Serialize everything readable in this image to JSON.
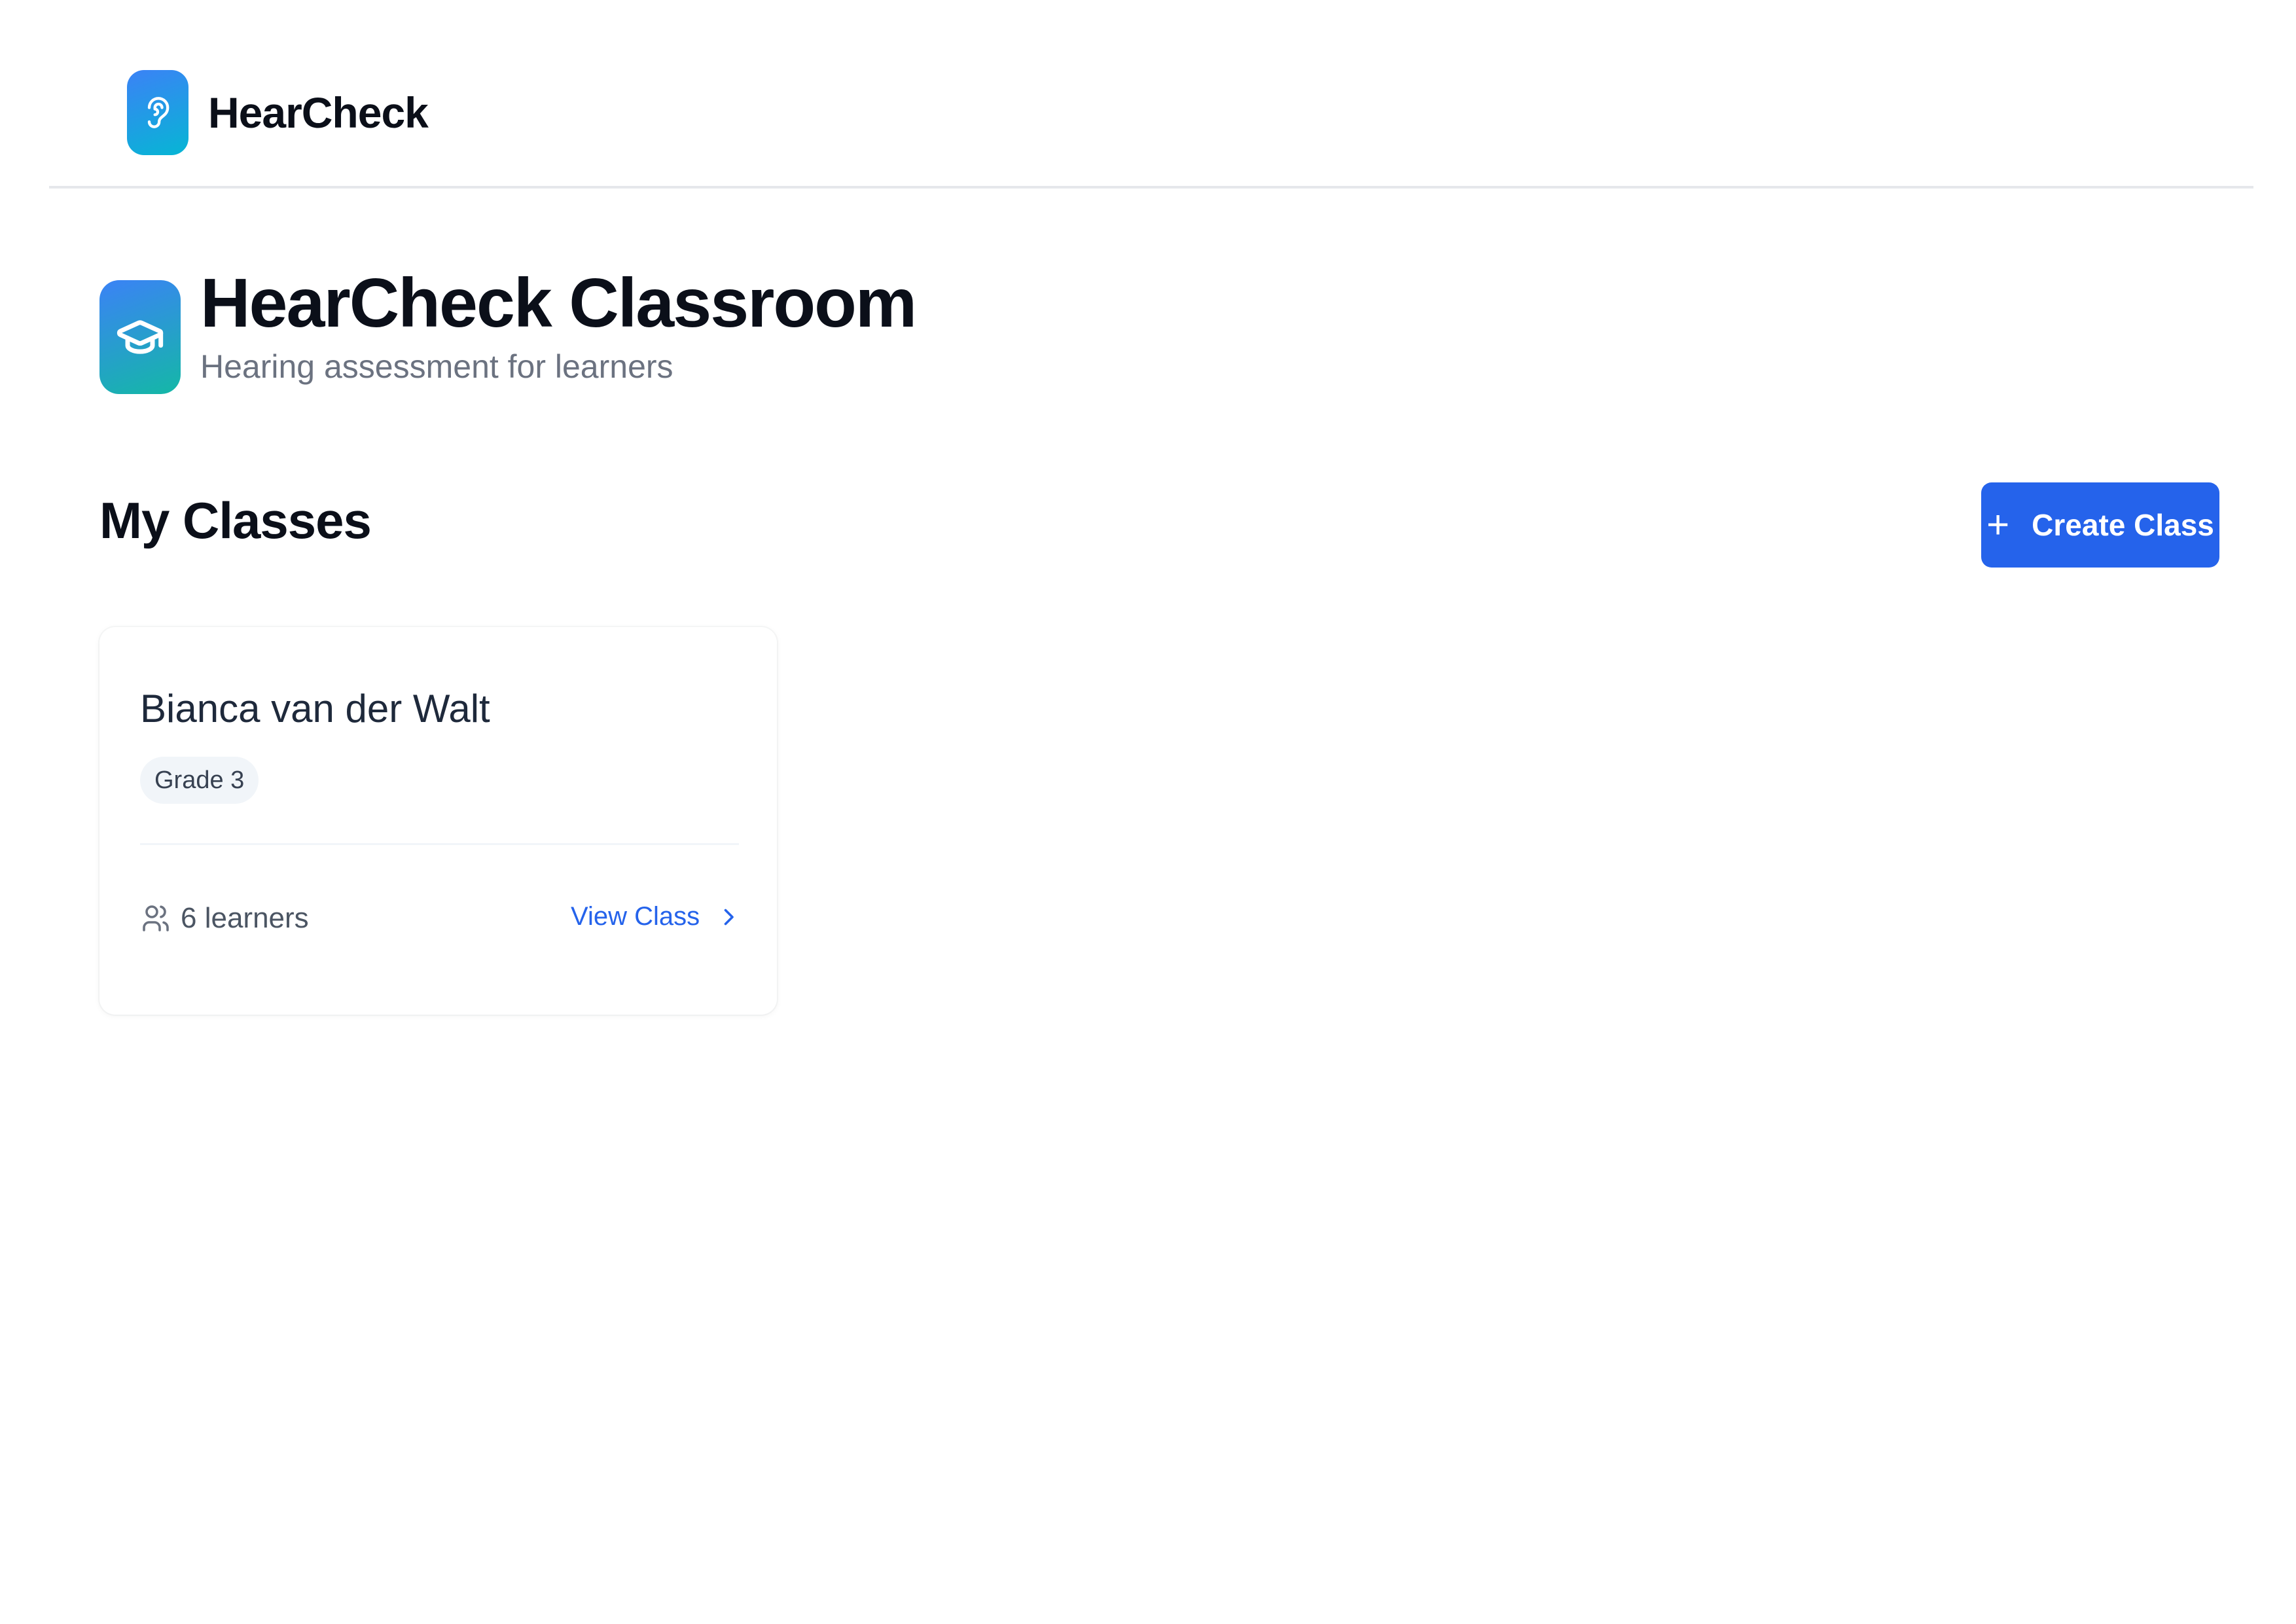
{
  "app": {
    "brand_name": "HearCheck",
    "brand_icon": "ear-icon"
  },
  "hero": {
    "title": "HearCheck Classroom",
    "subtitle": "Hearing assessment for learners",
    "icon": "graduation-cap-icon"
  },
  "classes_section": {
    "title": "My Classes",
    "create_button_label": "Create Class",
    "create_button_icon": "plus-icon",
    "classes": [
      {
        "name": "Bianca van der Walt",
        "grade": "Grade 3",
        "learners": "6 learners",
        "view_label": "View Class"
      }
    ]
  },
  "colors": {
    "primary": "#2563eb",
    "logo_gradient_start": "#3b82f6",
    "logo_gradient_end": "#06b6d4",
    "heading": "#0b0f19",
    "muted": "#6b7280",
    "badge_bg": "#f1f5f9"
  }
}
